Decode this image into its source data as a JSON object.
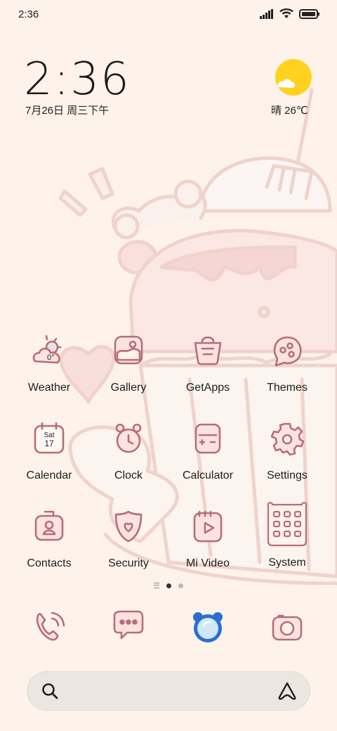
{
  "status_bar": {
    "time": "2:36"
  },
  "clock_widget": {
    "time": "2:36",
    "date": "7月26日 周三下午"
  },
  "weather_widget": {
    "text": "晴 26℃"
  },
  "apps": [
    {
      "label": "Weather",
      "icon": "weather-icon",
      "temp": "0°"
    },
    {
      "label": "Gallery",
      "icon": "gallery-icon"
    },
    {
      "label": "GetApps",
      "icon": "getapps-icon"
    },
    {
      "label": "Themes",
      "icon": "themes-icon"
    },
    {
      "label": "Calendar",
      "icon": "calendar-icon",
      "day": "Sat",
      "date": "17"
    },
    {
      "label": "Clock",
      "icon": "clock-icon"
    },
    {
      "label": "Calculator",
      "icon": "calculator-icon"
    },
    {
      "label": "Settings",
      "icon": "settings-icon"
    },
    {
      "label": "Contacts",
      "icon": "contacts-icon"
    },
    {
      "label": "Security",
      "icon": "security-icon"
    },
    {
      "label": "Mi Video",
      "icon": "mi-video-icon"
    },
    {
      "label": "System",
      "icon": "system-folder-icon"
    }
  ],
  "dock": [
    "phone-icon",
    "messages-icon",
    "browser-icon",
    "camera-icon"
  ],
  "colors": {
    "icon_stroke": "#b86d77",
    "icon_fill": "#fbe3e1",
    "background": "#fdf3ea",
    "sun": "#ffd21f"
  }
}
